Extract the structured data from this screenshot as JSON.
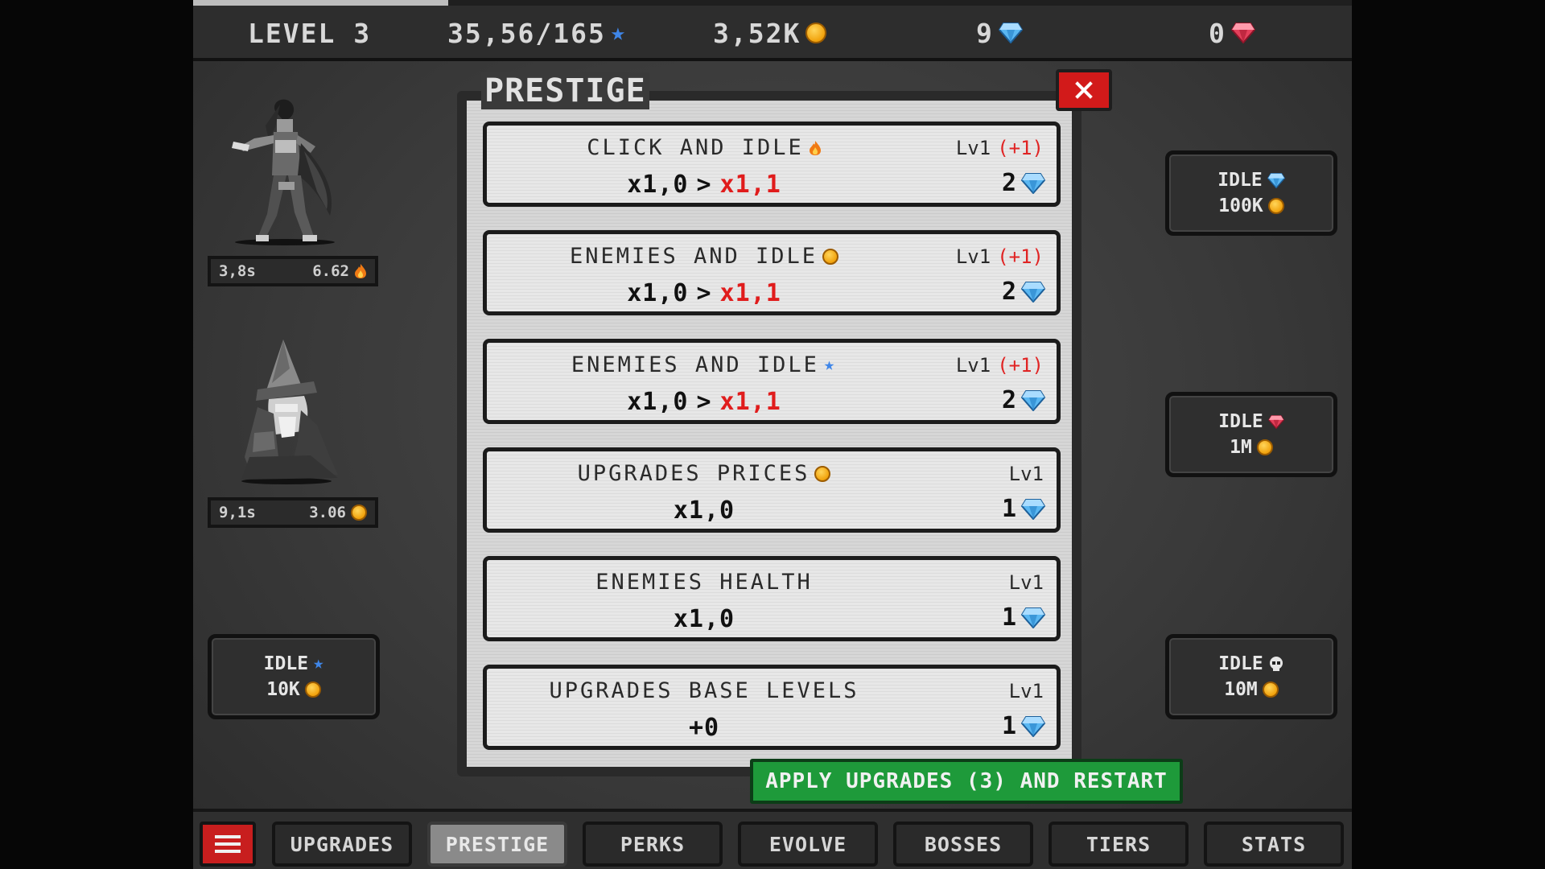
{
  "topbar": {
    "level": "LEVEL 3",
    "stars": "35,56/165",
    "coins": "3,52K",
    "blue_gems": "9",
    "red_gems": "0",
    "level_progress_fraction": 0.22
  },
  "heroes": [
    {
      "name_icon": "warrior-sprite",
      "time": "3,8s",
      "value": "6.62",
      "value_icon": "fire-icon"
    },
    {
      "name_icon": "wizard-sprite",
      "time": "9,1s",
      "value": "3.06",
      "value_icon": "coin-icon"
    }
  ],
  "idle_cards": {
    "left": {
      "label": "IDLE",
      "icon": "star-icon",
      "cost": "10K",
      "cost_icon": "coin-icon"
    },
    "right_1": {
      "label": "IDLE",
      "icon": "blue-gem-icon",
      "cost": "100K",
      "cost_icon": "coin-icon"
    },
    "right_2": {
      "label": "IDLE",
      "icon": "red-gem-icon",
      "cost": "1M",
      "cost_icon": "coin-icon"
    },
    "right_3": {
      "label": "IDLE",
      "icon": "skull-icon",
      "cost": "10M",
      "cost_icon": "coin-icon"
    }
  },
  "modal": {
    "title": "PRESTIGE",
    "close_icon": "close-icon",
    "upgrades": [
      {
        "title": "CLICK AND IDLE",
        "title_icon": "fire-icon",
        "level": "Lv1",
        "level_plus": "(+1)",
        "current": "x1,0",
        "arrow": ">",
        "next": "x1,1",
        "cost": "2",
        "cost_icon": "blue-gem-icon"
      },
      {
        "title": "ENEMIES AND IDLE",
        "title_icon": "coin-icon",
        "level": "Lv1",
        "level_plus": "(+1)",
        "current": "x1,0",
        "arrow": ">",
        "next": "x1,1",
        "cost": "2",
        "cost_icon": "blue-gem-icon"
      },
      {
        "title": "ENEMIES AND IDLE",
        "title_icon": "star-icon",
        "level": "Lv1",
        "level_plus": "(+1)",
        "current": "x1,0",
        "arrow": ">",
        "next": "x1,1",
        "cost": "2",
        "cost_icon": "blue-gem-icon"
      },
      {
        "title": "UPGRADES PRICES",
        "title_icon": "coin-icon",
        "level": "Lv1",
        "level_plus": "",
        "current": "x1,0",
        "arrow": "",
        "next": "",
        "cost": "1",
        "cost_icon": "blue-gem-icon"
      },
      {
        "title": "ENEMIES HEALTH",
        "title_icon": "",
        "level": "Lv1",
        "level_plus": "",
        "current": "x1,0",
        "arrow": "",
        "next": "",
        "cost": "1",
        "cost_icon": "blue-gem-icon"
      },
      {
        "title": "UPGRADES BASE LEVELS",
        "title_icon": "",
        "level": "Lv1",
        "level_plus": "",
        "current": "+0",
        "arrow": "",
        "next": "",
        "cost": "1",
        "cost_icon": "blue-gem-icon"
      }
    ],
    "apply_label": "APPLY UPGRADES (3) AND RESTART"
  },
  "nav": {
    "menu_icon": "hamburger-menu-icon",
    "tabs": [
      "UPGRADES",
      "PRESTIGE",
      "PERKS",
      "EVOLVE",
      "BOSSES",
      "TIERS",
      "STATS"
    ],
    "active": "PRESTIGE"
  },
  "colors": {
    "accent_red": "#d21a1a",
    "accent_green": "#1e9a3a",
    "star_blue": "#3f86e8",
    "coin_gold": "#f1a20c",
    "gem_blue": "#55b5f0",
    "gem_red": "#e0304a"
  }
}
